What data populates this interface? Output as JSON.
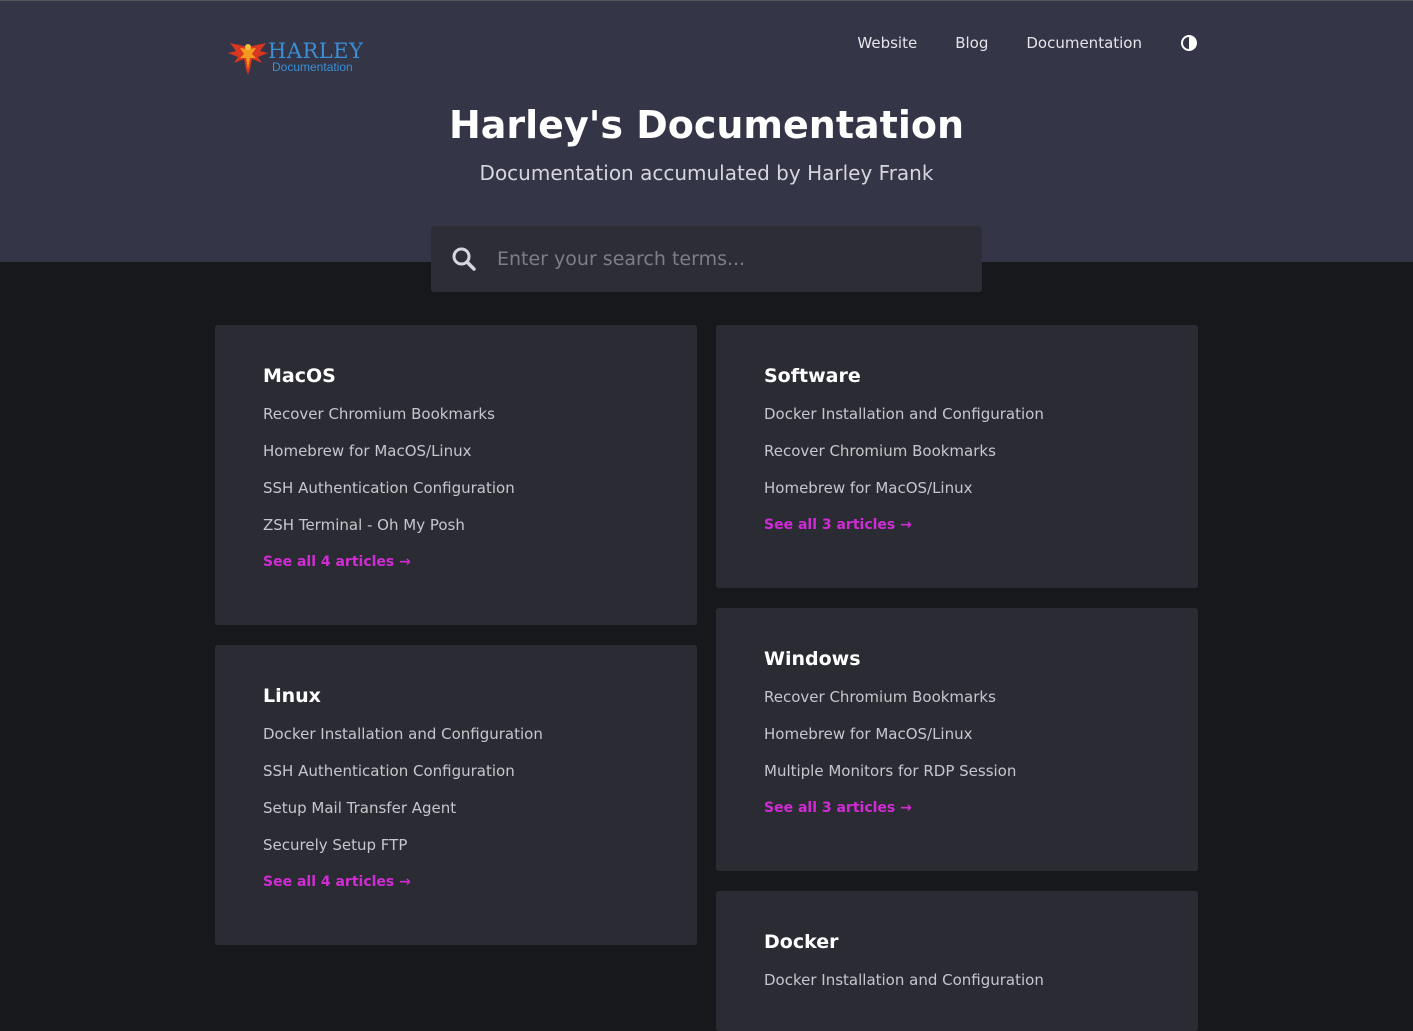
{
  "brand": {
    "logo_title": "HARLEY",
    "logo_subtitle": "Documentation"
  },
  "nav": {
    "items": [
      "Website",
      "Blog",
      "Documentation"
    ]
  },
  "hero": {
    "title": "Harley's Documentation",
    "subtitle": "Documentation accumulated by Harley Frank"
  },
  "search": {
    "placeholder": "Enter your search terms..."
  },
  "categories": [
    {
      "name": "MacOS",
      "articles": [
        "Recover Chromium Bookmarks",
        "Homebrew for MacOS/Linux",
        "SSH Authentication Configuration",
        "ZSH Terminal - Oh My Posh"
      ],
      "see_all": "See all 4 articles →"
    },
    {
      "name": "Linux",
      "articles": [
        "Docker Installation and Configuration",
        "SSH Authentication Configuration",
        "Setup Mail Transfer Agent",
        "Securely Setup FTP"
      ],
      "see_all": "See all 4 articles →"
    },
    {
      "name": "Software",
      "articles": [
        "Docker Installation and Configuration",
        "Recover Chromium Bookmarks",
        "Homebrew for MacOS/Linux"
      ],
      "see_all": "See all 3 articles →"
    },
    {
      "name": "Windows",
      "articles": [
        "Recover Chromium Bookmarks",
        "Homebrew for MacOS/Linux",
        "Multiple Monitors for RDP Session"
      ],
      "see_all": "See all 3 articles →"
    },
    {
      "name": "Docker",
      "articles": [
        "Docker Installation and Configuration"
      ]
    }
  ],
  "colors": {
    "hero_bg": "#343546",
    "page_bg": "#17181c",
    "card_bg": "#2b2c33",
    "accent": "#d12bd6",
    "logo_blue": "#3a8fd6",
    "logo_red": "#d9361f"
  },
  "icons": {
    "logo": "phoenix-logo-icon",
    "theme": "contrast-half-circle-icon",
    "search": "magnifier-search-icon"
  }
}
